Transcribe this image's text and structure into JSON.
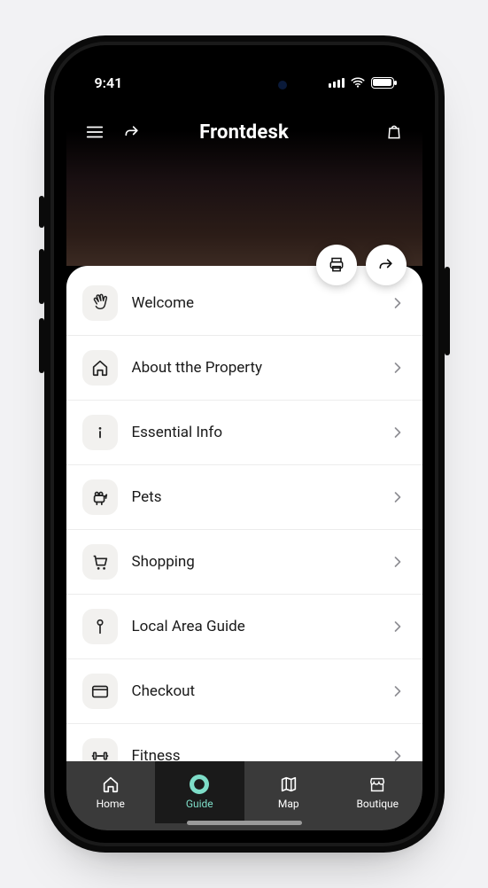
{
  "status": {
    "time": "9:41"
  },
  "header": {
    "title": "Frontdesk",
    "menu_icon": "menu-icon",
    "share_icon": "share-icon",
    "bag_icon": "shopping-bag-icon"
  },
  "hero_actions": {
    "print_icon": "printer-icon",
    "share_icon": "share-icon"
  },
  "menu": [
    {
      "icon": "wave-icon",
      "label": "Welcome"
    },
    {
      "icon": "home-icon",
      "label": "About tthe Property"
    },
    {
      "icon": "info-icon",
      "label": "Essential Info"
    },
    {
      "icon": "pet-icon",
      "label": "Pets"
    },
    {
      "icon": "cart-icon",
      "label": "Shopping"
    },
    {
      "icon": "pin-icon",
      "label": "Local Area Guide"
    },
    {
      "icon": "card-icon",
      "label": "Checkout"
    },
    {
      "icon": "dumbbell-icon",
      "label": "Fitness"
    }
  ],
  "tabs": [
    {
      "icon": "home-tab-icon",
      "label": "Home",
      "active": false
    },
    {
      "icon": "info-tab-icon",
      "label": "Guide",
      "active": true
    },
    {
      "icon": "map-tab-icon",
      "label": "Map",
      "active": false
    },
    {
      "icon": "boutique-tab-icon",
      "label": "Boutique",
      "active": false
    }
  ],
  "colors": {
    "background": "#f2f2f4",
    "accent": "#7eddc8"
  }
}
